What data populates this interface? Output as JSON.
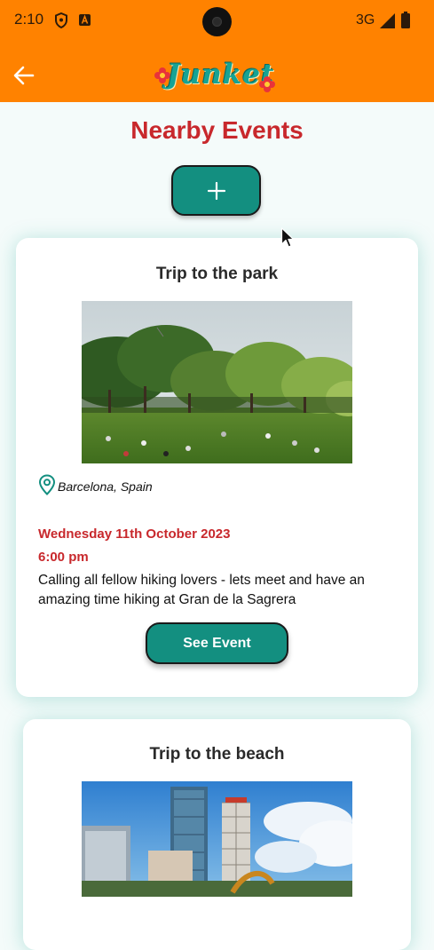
{
  "status_bar": {
    "time": "2:10",
    "network": "3G",
    "icons": [
      "shield-icon",
      "a-badge-icon",
      "signal-icon",
      "battery-icon"
    ]
  },
  "header": {
    "back_icon": "arrow-left-icon",
    "logo_text": "Junket"
  },
  "page": {
    "title": "Nearby Events",
    "add_button_icon": "plus-icon"
  },
  "events": [
    {
      "title": "Trip to the park",
      "location": "Barcelona, Spain",
      "date": "Wednesday 11th October 2023",
      "time": "6:00 pm",
      "description": "Calling all fellow hiking lovers - lets meet and have an amazing time hiking at Gran de la Sagrera",
      "button_label": "See Event"
    },
    {
      "title": "Trip to the beach"
    }
  ],
  "colors": {
    "header_bg": "#ff8200",
    "accent_red": "#c8282c",
    "button_teal": "#138f80",
    "logo_teal": "#16a394",
    "card_glow": "#40b4a5"
  }
}
